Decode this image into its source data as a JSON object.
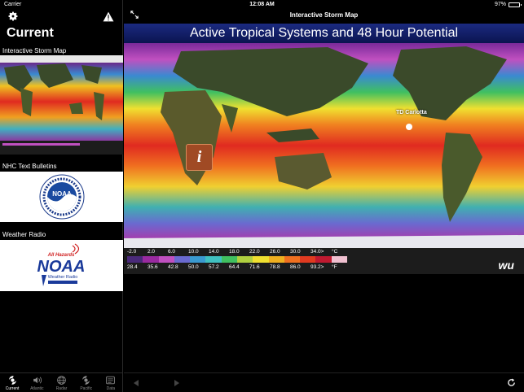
{
  "status": {
    "carrier": "Carrier",
    "time": "12:08 AM",
    "battery": "97%",
    "battery_level": 0.97
  },
  "sidebar": {
    "title": "Current",
    "sections": [
      {
        "label": "Interactive Storm Map"
      },
      {
        "label": "NHC Text Bulletins"
      },
      {
        "label": "Weather Radio"
      }
    ],
    "noaa_label": "NOAA",
    "radio": {
      "top": "All Hazards",
      "brand": "NOAA",
      "sub": "Weather Radio"
    }
  },
  "tabs": [
    {
      "label": "Current",
      "icon": "hurricane-icon",
      "active": true
    },
    {
      "label": "Atlantic",
      "icon": "speaker-icon",
      "active": false
    },
    {
      "label": "Radar",
      "icon": "globe-icon",
      "active": false
    },
    {
      "label": "Pacific",
      "icon": "hurricane-icon",
      "active": false
    },
    {
      "label": "Data",
      "icon": "data-icon",
      "active": false
    }
  ],
  "main": {
    "nav_title": "Interactive Storm Map",
    "map_title": "Active Tropical Systems and 48 Hour Potential",
    "storm_label": "TD Carlotta",
    "info_glyph": "i",
    "legend_c": [
      "-2.0",
      "2.0",
      "6.0",
      "10.0",
      "14.0",
      "18.0",
      "22.0",
      "26.0",
      "30.0",
      "34.0>"
    ],
    "legend_c_unit": "°C",
    "legend_f": [
      "28.4",
      "35.6",
      "42.8",
      "50.0",
      "57.2",
      "64.4",
      "71.6",
      "78.8",
      "86.0",
      "93.2>"
    ],
    "legend_f_unit": "°F",
    "legend_colors": [
      "#4a2a7a",
      "#9a2aa0",
      "#c050c0",
      "#6a6ad0",
      "#3a9ad0",
      "#40c0c0",
      "#40c060",
      "#b0d040",
      "#f0e030",
      "#f0b020",
      "#f07020",
      "#e03a20",
      "#c01a30",
      "#f0c0d0"
    ],
    "logo": "wu"
  },
  "colors": {
    "accent": "#ffffff",
    "header_blue": "#1b2a80",
    "info_button": "#a04a24"
  }
}
